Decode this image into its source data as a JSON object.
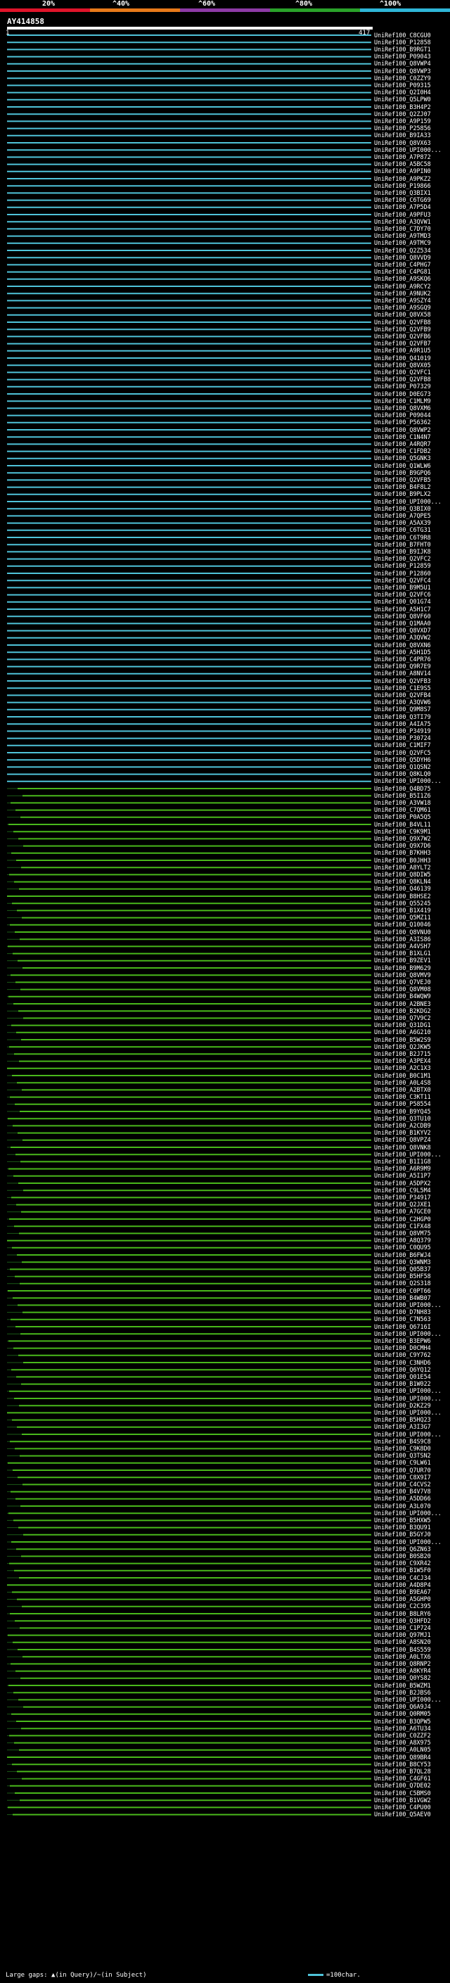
{
  "scale": {
    "labels": [
      "20%",
      "^40%",
      "^60%",
      "^80%",
      "^100%"
    ],
    "colors": [
      "#e0142a",
      "#e87a1a",
      "#8e3aa6",
      "#2aa22a",
      "#2fb6d8"
    ]
  },
  "query": {
    "id": "AY414858",
    "start": "1",
    "end": "417"
  },
  "colors": {
    "cyan": "#4fc3d9",
    "green": "#49b81b",
    "dark_cyan": "#1a5d68",
    "dark_green": "#1b5a16"
  },
  "hits": [
    {
      "label": "UniRef100_C8CGU0",
      "cls": "c"
    },
    {
      "label": "UniRef100_P12858",
      "cls": "c"
    },
    {
      "label": "UniRef100_B9RGT1",
      "cls": "c"
    },
    {
      "label": "UniRef100_P09043",
      "cls": "c"
    },
    {
      "label": "UniRef100_Q8VWP4",
      "cls": "c"
    },
    {
      "label": "UniRef100_Q8VWP3",
      "cls": "c"
    },
    {
      "label": "UniRef100_C0ZZY9",
      "cls": "c"
    },
    {
      "label": "UniRef100_P09315",
      "cls": "c"
    },
    {
      "label": "UniRef100_Q2I0H4",
      "cls": "c"
    },
    {
      "label": "UniRef100_Q5LPW0",
      "cls": "c"
    },
    {
      "label": "UniRef100_B3H4P2",
      "cls": "c"
    },
    {
      "label": "UniRef100_Q2ZJ07",
      "cls": "c"
    },
    {
      "label": "UniRef100_A9P159",
      "cls": "c"
    },
    {
      "label": "UniRef100_P25856",
      "cls": "c"
    },
    {
      "label": "UniRef100_B9IA33",
      "cls": "c"
    },
    {
      "label": "UniRef100_Q8VX63",
      "cls": "c"
    },
    {
      "label": "UniRef100_UPI000...",
      "cls": "c"
    },
    {
      "label": "UniRef100_A7P872",
      "cls": "c"
    },
    {
      "label": "UniRef100_A5BC58",
      "cls": "c"
    },
    {
      "label": "UniRef100_A9PIN0",
      "cls": "c"
    },
    {
      "label": "UniRef100_A9PKZ2",
      "cls": "c"
    },
    {
      "label": "UniRef100_P19866",
      "cls": "c"
    },
    {
      "label": "UniRef100_Q3BIX1",
      "cls": "c"
    },
    {
      "label": "UniRef100_C6TG69",
      "cls": "c"
    },
    {
      "label": "UniRef100_A7P5D4",
      "cls": "c"
    },
    {
      "label": "UniRef100_A9PFU3",
      "cls": "c"
    },
    {
      "label": "UniRef100_A3QVW1",
      "cls": "c"
    },
    {
      "label": "UniRef100_C7DY70",
      "cls": "c"
    },
    {
      "label": "UniRef100_A9TMD3",
      "cls": "c"
    },
    {
      "label": "UniRef100_A9TMC9",
      "cls": "c"
    },
    {
      "label": "UniRef100_Q2Z534",
      "cls": "c"
    },
    {
      "label": "UniRef100_Q8VVD9",
      "cls": "c"
    },
    {
      "label": "UniRef100_C4PHG7",
      "cls": "c"
    },
    {
      "label": "UniRef100_C4PG81",
      "cls": "c"
    },
    {
      "label": "UniRef100_A9SKQ6",
      "cls": "c"
    },
    {
      "label": "UniRef100_A9RCY2",
      "cls": "c"
    },
    {
      "label": "UniRef100_A9NUK2",
      "cls": "c"
    },
    {
      "label": "UniRef100_A9SZY4",
      "cls": "c"
    },
    {
      "label": "UniRef100_A9SGQ9",
      "cls": "c"
    },
    {
      "label": "UniRef100_Q8VX58",
      "cls": "c"
    },
    {
      "label": "UniRef100_Q2VFB8",
      "cls": "c"
    },
    {
      "label": "UniRef100_Q2VFB9",
      "cls": "c"
    },
    {
      "label": "UniRef100_Q2VFB6",
      "cls": "c"
    },
    {
      "label": "UniRef100_Q2VFB7",
      "cls": "c"
    },
    {
      "label": "UniRef100_A9R1U5",
      "cls": "c"
    },
    {
      "label": "UniRef100_Q41019",
      "cls": "c"
    },
    {
      "label": "UniRef100_Q8VX05",
      "cls": "c"
    },
    {
      "label": "UniRef100_Q2VFC1",
      "cls": "c"
    },
    {
      "label": "UniRef100_Q2VFB8",
      "cls": "c"
    },
    {
      "label": "UniRef100_P07329",
      "cls": "c"
    },
    {
      "label": "UniRef100_D0EG73",
      "cls": "c"
    },
    {
      "label": "UniRef100_C1MLM9",
      "cls": "c"
    },
    {
      "label": "UniRef100_Q8VXM6",
      "cls": "c"
    },
    {
      "label": "UniRef100_P09044",
      "cls": "c"
    },
    {
      "label": "UniRef100_P56362",
      "cls": "c"
    },
    {
      "label": "UniRef100_Q8VWP2",
      "cls": "c"
    },
    {
      "label": "UniRef100_C1N4N7",
      "cls": "c"
    },
    {
      "label": "UniRef100_A4RQR7",
      "cls": "c"
    },
    {
      "label": "UniRef100_C1FDB2",
      "cls": "c"
    },
    {
      "label": "UniRef100_Q5GNK3",
      "cls": "c"
    },
    {
      "label": "UniRef100_Q1WLW6",
      "cls": "c"
    },
    {
      "label": "UniRef100_B9GPQ6",
      "cls": "c"
    },
    {
      "label": "UniRef100_Q2VFB5",
      "cls": "c"
    },
    {
      "label": "UniRef100_B4F8L2",
      "cls": "c"
    },
    {
      "label": "UniRef100_B9PLX2",
      "cls": "c"
    },
    {
      "label": "UniRef100_UPI000...",
      "cls": "c"
    },
    {
      "label": "UniRef100_Q3BIX0",
      "cls": "c"
    },
    {
      "label": "UniRef100_A7QPE5",
      "cls": "c"
    },
    {
      "label": "UniRef100_A5AX39",
      "cls": "c"
    },
    {
      "label": "UniRef100_C6TG31",
      "cls": "c"
    },
    {
      "label": "UniRef100_C6T9R8",
      "cls": "c"
    },
    {
      "label": "UniRef100_B7FHT0",
      "cls": "c"
    },
    {
      "label": "UniRef100_B9IJK8",
      "cls": "c"
    },
    {
      "label": "UniRef100_Q2VFC2",
      "cls": "c"
    },
    {
      "label": "UniRef100_P12859",
      "cls": "c"
    },
    {
      "label": "UniRef100_P12860",
      "cls": "c"
    },
    {
      "label": "UniRef100_Q2VFC4",
      "cls": "c"
    },
    {
      "label": "UniRef100_B9M5U1",
      "cls": "c"
    },
    {
      "label": "UniRef100_Q2VFC6",
      "cls": "c"
    },
    {
      "label": "UniRef100_Q01G74",
      "cls": "c"
    },
    {
      "label": "UniRef100_A5H1C7",
      "cls": "c"
    },
    {
      "label": "UniRef100_Q8VF60",
      "cls": "c"
    },
    {
      "label": "UniRef100_Q1MAA0",
      "cls": "c"
    },
    {
      "label": "UniRef100_Q8VXD7",
      "cls": "c"
    },
    {
      "label": "UniRef100_A3QVW2",
      "cls": "c"
    },
    {
      "label": "UniRef100_Q8VXN6",
      "cls": "c"
    },
    {
      "label": "UniRef100_A5H1D5",
      "cls": "c"
    },
    {
      "label": "UniRef100_C4PR76",
      "cls": "c"
    },
    {
      "label": "UniRef100_Q9R7E9",
      "cls": "c"
    },
    {
      "label": "UniRef100_A8NV14",
      "cls": "c"
    },
    {
      "label": "UniRef100_Q2VFB3",
      "cls": "c"
    },
    {
      "label": "UniRef100_C1E9S5",
      "cls": "c"
    },
    {
      "label": "UniRef100_Q2VFB4",
      "cls": "c"
    },
    {
      "label": "UniRef100_A3QVW6",
      "cls": "c"
    },
    {
      "label": "UniRef100_Q9M8S7",
      "cls": "c"
    },
    {
      "label": "UniRef100_Q3TI79",
      "cls": "c"
    },
    {
      "label": "UniRef100_A4IA75",
      "cls": "c"
    },
    {
      "label": "UniRef100_P34919",
      "cls": "c"
    },
    {
      "label": "UniRef100_P30724",
      "cls": "c"
    },
    {
      "label": "UniRef100_C1MIF7",
      "cls": "c"
    },
    {
      "label": "UniRef100_Q2VFC5",
      "cls": "c"
    },
    {
      "label": "UniRef100_Q5DYH6",
      "cls": "c"
    },
    {
      "label": "UniRef100_Q1QSN2",
      "cls": "c"
    },
    {
      "label": "UniRef100_Q8KLQ0",
      "cls": "c"
    },
    {
      "label": "UniRef100_UPI000...",
      "cls": "c"
    },
    {
      "label": "UniRef100_Q4BD75",
      "cls": "g"
    },
    {
      "label": "UniRef100_B5I1Z6",
      "cls": "g"
    },
    {
      "label": "UniRef100_A3VW18",
      "cls": "g"
    },
    {
      "label": "UniRef100_C7QM61",
      "cls": "g"
    },
    {
      "label": "UniRef100_P0A5Q5",
      "cls": "g"
    },
    {
      "label": "UniRef100_B4VL11",
      "cls": "g"
    },
    {
      "label": "UniRef100_C9K9M1",
      "cls": "g"
    },
    {
      "label": "UniRef100_Q9X7W2",
      "cls": "g"
    },
    {
      "label": "UniRef100_Q9X7D6",
      "cls": "g"
    },
    {
      "label": "UniRef100_B7KHH3",
      "cls": "g"
    },
    {
      "label": "UniRef100_B0JHH3",
      "cls": "g"
    },
    {
      "label": "UniRef100_A8YLT2",
      "cls": "g"
    },
    {
      "label": "UniRef100_Q8DIW5",
      "cls": "g"
    },
    {
      "label": "UniRef100_Q8KLN4",
      "cls": "g"
    },
    {
      "label": "UniRef100_Q46139",
      "cls": "g"
    },
    {
      "label": "UniRef100_B8HSE2",
      "cls": "g"
    },
    {
      "label": "UniRef100_Q55245",
      "cls": "g"
    },
    {
      "label": "UniRef100_B1X419",
      "cls": "g"
    },
    {
      "label": "UniRef100_Q5MZ11",
      "cls": "g"
    },
    {
      "label": "UniRef100_Q10046",
      "cls": "g"
    },
    {
      "label": "UniRef100_Q8VNU0",
      "cls": "g"
    },
    {
      "label": "UniRef100_A3IS86",
      "cls": "g"
    },
    {
      "label": "UniRef100_A4VSH7",
      "cls": "g"
    },
    {
      "label": "UniRef100_B1XLG1",
      "cls": "g"
    },
    {
      "label": "UniRef100_B9ZEV1",
      "cls": "g"
    },
    {
      "label": "UniRef100_B9M629",
      "cls": "g"
    },
    {
      "label": "UniRef100_Q8VMV9",
      "cls": "g"
    },
    {
      "label": "UniRef100_Q7VEJ0",
      "cls": "g"
    },
    {
      "label": "UniRef100_Q8VM08",
      "cls": "g"
    },
    {
      "label": "UniRef100_B4WQW9",
      "cls": "g"
    },
    {
      "label": "UniRef100_A2BNE3",
      "cls": "g"
    },
    {
      "label": "UniRef100_B2KDG2",
      "cls": "g"
    },
    {
      "label": "UniRef100_Q7V9C2",
      "cls": "g"
    },
    {
      "label": "UniRef100_Q31DG1",
      "cls": "g"
    },
    {
      "label": "UniRef100_A6G210",
      "cls": "g"
    },
    {
      "label": "UniRef100_B5W2S9",
      "cls": "g"
    },
    {
      "label": "UniRef100_Q2JKW5",
      "cls": "g"
    },
    {
      "label": "UniRef100_B2J715",
      "cls": "g"
    },
    {
      "label": "UniRef100_A3PEX4",
      "cls": "g"
    },
    {
      "label": "UniRef100_A2C1X3",
      "cls": "g"
    },
    {
      "label": "UniRef100_B0C1M1",
      "cls": "g"
    },
    {
      "label": "UniRef100_A0L4S8",
      "cls": "g"
    },
    {
      "label": "UniRef100_A2BTX0",
      "cls": "g"
    },
    {
      "label": "UniRef100_C3KT11",
      "cls": "g"
    },
    {
      "label": "UniRef100_P58554",
      "cls": "g"
    },
    {
      "label": "UniRef100_B9YQ45",
      "cls": "g"
    },
    {
      "label": "UniRef100_Q3TU10",
      "cls": "g"
    },
    {
      "label": "UniRef100_A2CDB9",
      "cls": "g"
    },
    {
      "label": "UniRef100_B1KYV2",
      "cls": "g"
    },
    {
      "label": "UniRef100_Q8VPZ4",
      "cls": "g"
    },
    {
      "label": "UniRef100_Q8VNK8",
      "cls": "g"
    },
    {
      "label": "UniRef100_UPI000...",
      "cls": "g"
    },
    {
      "label": "UniRef100_B1I1G8",
      "cls": "g"
    },
    {
      "label": "UniRef100_A6R9M9",
      "cls": "g"
    },
    {
      "label": "UniRef100_A5I1P7",
      "cls": "g"
    },
    {
      "label": "UniRef100_A5DPX2",
      "cls": "g"
    },
    {
      "label": "UniRef100_C9L5M4",
      "cls": "g"
    },
    {
      "label": "UniRef100_P34917",
      "cls": "g"
    },
    {
      "label": "UniRef100_Q2JXE1",
      "cls": "g"
    },
    {
      "label": "UniRef100_A7GCE0",
      "cls": "g"
    },
    {
      "label": "UniRef100_C2HGP0",
      "cls": "g"
    },
    {
      "label": "UniRef100_C1FX48",
      "cls": "g"
    },
    {
      "label": "UniRef100_Q8VM75",
      "cls": "g"
    },
    {
      "label": "UniRef100_A8Q379",
      "cls": "g"
    },
    {
      "label": "UniRef100_C0QU95",
      "cls": "g"
    },
    {
      "label": "UniRef100_B6FWJ4",
      "cls": "g"
    },
    {
      "label": "UniRef100_Q3WNM3",
      "cls": "g"
    },
    {
      "label": "UniRef100_Q05B37",
      "cls": "g"
    },
    {
      "label": "UniRef100_B5HF58",
      "cls": "g"
    },
    {
      "label": "UniRef100_Q2S318",
      "cls": "g"
    },
    {
      "label": "UniRef100_C0PT66",
      "cls": "g"
    },
    {
      "label": "UniRef100_B4WB07",
      "cls": "g"
    },
    {
      "label": "UniRef100_UPI000...",
      "cls": "g"
    },
    {
      "label": "UniRef100_D7NH83",
      "cls": "g"
    },
    {
      "label": "UniRef100_C7N563",
      "cls": "g"
    },
    {
      "label": "UniRef100_Q6716I",
      "cls": "g"
    },
    {
      "label": "UniRef100_UPI000...",
      "cls": "g"
    },
    {
      "label": "UniRef100_B3EPW6",
      "cls": "g"
    },
    {
      "label": "UniRef100_D0CMH4",
      "cls": "g"
    },
    {
      "label": "UniRef100_C9Y762",
      "cls": "g"
    },
    {
      "label": "UniRef100_C3NHD6",
      "cls": "g"
    },
    {
      "label": "UniRef100_Q6YQ12",
      "cls": "g"
    },
    {
      "label": "UniRef100_Q01E54",
      "cls": "g"
    },
    {
      "label": "UniRef100_B1W022",
      "cls": "g"
    },
    {
      "label": "UniRef100_UPI000...",
      "cls": "g"
    },
    {
      "label": "UniRef100_UPI000...",
      "cls": "g"
    },
    {
      "label": "UniRef100_D2KZ29",
      "cls": "g"
    },
    {
      "label": "UniRef100_UPI000...",
      "cls": "g"
    },
    {
      "label": "UniRef100_B5HQ23",
      "cls": "g"
    },
    {
      "label": "UniRef100_A3I3G7",
      "cls": "g"
    },
    {
      "label": "UniRef100_UPI000...",
      "cls": "g"
    },
    {
      "label": "UniRef100_B4S9C8",
      "cls": "g"
    },
    {
      "label": "UniRef100_C9K8D0",
      "cls": "g"
    },
    {
      "label": "UniRef100_Q3TSN2",
      "cls": "g"
    },
    {
      "label": "UniRef100_C9LW61",
      "cls": "g"
    },
    {
      "label": "UniRef100_Q7UR70",
      "cls": "g"
    },
    {
      "label": "UniRef100_C8X9I7",
      "cls": "g"
    },
    {
      "label": "UniRef100_C4CVS2",
      "cls": "g"
    },
    {
      "label": "UniRef100_B4V7V8",
      "cls": "g"
    },
    {
      "label": "UniRef100_A5DD66",
      "cls": "g"
    },
    {
      "label": "UniRef100_A3L070",
      "cls": "g"
    },
    {
      "label": "UniRef100_UPI000...",
      "cls": "g"
    },
    {
      "label": "UniRef100_B5HXW5",
      "cls": "g"
    },
    {
      "label": "UniRef100_B3QU91",
      "cls": "g"
    },
    {
      "label": "UniRef100_B5GYJ0",
      "cls": "g"
    },
    {
      "label": "UniRef100_UPI000...",
      "cls": "g"
    },
    {
      "label": "UniRef100_Q6ZN63",
      "cls": "g"
    },
    {
      "label": "UniRef100_B0SB20",
      "cls": "g"
    },
    {
      "label": "UniRef100_C9XR42",
      "cls": "g"
    },
    {
      "label": "UniRef100_B1W5F0",
      "cls": "g"
    },
    {
      "label": "UniRef100_C4CJ34",
      "cls": "g"
    },
    {
      "label": "UniRef100_A4D8P4",
      "cls": "g"
    },
    {
      "label": "UniRef100_B9EA67",
      "cls": "g"
    },
    {
      "label": "UniRef100_A5GHP0",
      "cls": "g"
    },
    {
      "label": "UniRef100_C2C395",
      "cls": "g"
    },
    {
      "label": "UniRef100_B8LRY6",
      "cls": "g"
    },
    {
      "label": "UniRef100_Q3HFD2",
      "cls": "g"
    },
    {
      "label": "UniRef100_C1P724",
      "cls": "g"
    },
    {
      "label": "UniRef100_Q97MJ1",
      "cls": "g"
    },
    {
      "label": "UniRef100_A8SN20",
      "cls": "g"
    },
    {
      "label": "UniRef100_B4S559",
      "cls": "g"
    },
    {
      "label": "UniRef100_A0LTX6",
      "cls": "g"
    },
    {
      "label": "UniRef100_Q8RNP2",
      "cls": "g"
    },
    {
      "label": "UniRef100_A8KYR4",
      "cls": "g"
    },
    {
      "label": "UniRef100_Q0YS82",
      "cls": "g"
    },
    {
      "label": "UniRef100_B5WZM1",
      "cls": "g"
    },
    {
      "label": "UniRef100_B2JBS6",
      "cls": "g"
    },
    {
      "label": "UniRef100_UPI000...",
      "cls": "g"
    },
    {
      "label": "UniRef100_Q6A9J4",
      "cls": "g"
    },
    {
      "label": "UniRef100_Q0RM05",
      "cls": "g"
    },
    {
      "label": "UniRef100_B3QPW5",
      "cls": "g"
    },
    {
      "label": "UniRef100_A6TU34",
      "cls": "g"
    },
    {
      "label": "UniRef100_C0ZZF2",
      "cls": "g"
    },
    {
      "label": "UniRef100_A8X975",
      "cls": "g"
    },
    {
      "label": "UniRef100_A0LN05",
      "cls": "g"
    },
    {
      "label": "UniRef100_Q89BR4",
      "cls": "g"
    },
    {
      "label": "UniRef100_B8CY53",
      "cls": "g"
    },
    {
      "label": "UniRef100_B7QL28",
      "cls": "g"
    },
    {
      "label": "UniRef100_C4GF61",
      "cls": "g"
    },
    {
      "label": "UniRef100_Q7DE02",
      "cls": "g"
    },
    {
      "label": "UniRef100_C5BMS0",
      "cls": "g"
    },
    {
      "label": "UniRef100_B1VGW2",
      "cls": "g"
    },
    {
      "label": "UniRef100_C4PU00",
      "cls": "g"
    },
    {
      "label": "UniRef100_Q5AEV0",
      "cls": "g"
    }
  ],
  "footer": {
    "gaps": "Large gaps: ▲(in Query)/~(in Subject)",
    "scale": "=100char."
  }
}
